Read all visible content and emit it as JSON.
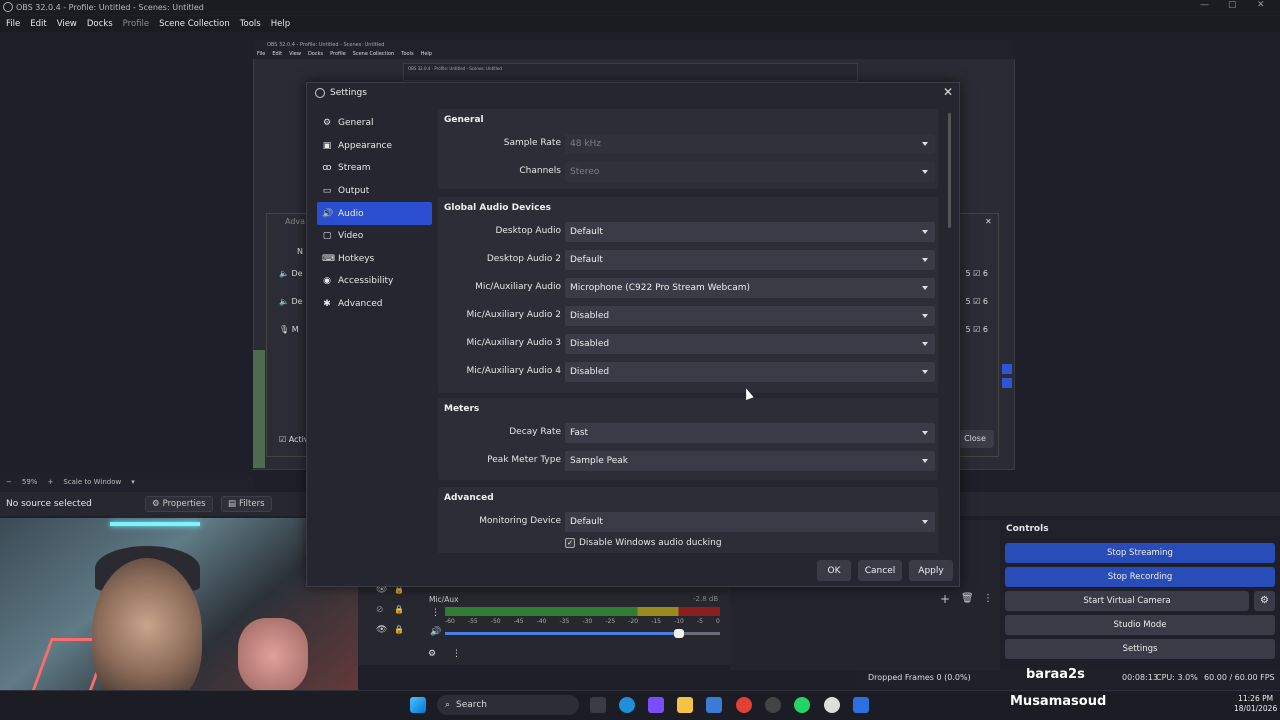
{
  "window": {
    "title": "OBS 32.0.4 - Profile: Untitled - Scenes: Untitled"
  },
  "menu": [
    "File",
    "Edit",
    "View",
    "Docks",
    "Profile",
    "Scene Collection",
    "Tools",
    "Help"
  ],
  "preview": {
    "mini_title": "OBS 32.0.4 - Profile: Untitled - Scenes: Untitled",
    "mini_menu": [
      "File",
      "Edit",
      "View",
      "Docks",
      "Profile",
      "Scene Collection",
      "Tools",
      "Help"
    ],
    "bg_dialog_title": "Adva",
    "bg_rows": [
      "N",
      "De",
      "De",
      "M"
    ],
    "bg_checks": [
      "5",
      "5",
      "5"
    ],
    "bg_active": "Activ",
    "bg_close": "Close"
  },
  "status": {
    "zoom": "59%",
    "scale": "Scale to Window"
  },
  "sources": {
    "no_source": "No source selected",
    "properties": "Properties",
    "filters": "Filters"
  },
  "mixer": {
    "label": "Mic/Aux",
    "db": "-2.8 dB",
    "ticks": [
      "-60",
      "-55",
      "-50",
      "-45",
      "-40",
      "-35",
      "-30",
      "-25",
      "-20",
      "-15",
      "-10",
      "-5",
      "0"
    ],
    "volume_fraction": 0.85
  },
  "controls": {
    "header": "Controls",
    "stop_streaming": "Stop Streaming",
    "stop_recording": "Stop Recording",
    "start_virtual_camera": "Start Virtual Camera",
    "studio_mode": "Studio Mode",
    "settings": "Settings"
  },
  "statusbar": {
    "dropped": "Dropped Frames 0 (0.0%)",
    "time": "00:08:13",
    "cpu": "CPU: 3.0%",
    "fps": "60.00 / 60.00 FPS"
  },
  "overlay": {
    "name_top": "baraa2s",
    "name_bottom": "Musamasoud"
  },
  "taskbar": {
    "search": "Search",
    "clock_time": "11:26 PM",
    "clock_date": "18/01/2026"
  },
  "settings": {
    "title": "Settings",
    "nav": [
      {
        "label": "General",
        "icon": "gear-icon"
      },
      {
        "label": "Appearance",
        "icon": "appearance-icon"
      },
      {
        "label": "Stream",
        "icon": "antenna-icon"
      },
      {
        "label": "Output",
        "icon": "monitor-icon"
      },
      {
        "label": "Audio",
        "icon": "speaker-icon"
      },
      {
        "label": "Video",
        "icon": "video-icon"
      },
      {
        "label": "Hotkeys",
        "icon": "keyboard-icon"
      },
      {
        "label": "Accessibility",
        "icon": "accessibility-icon"
      },
      {
        "label": "Advanced",
        "icon": "wrench-icon"
      }
    ],
    "active_nav": "Audio",
    "general": {
      "header": "General",
      "sample_rate_label": "Sample Rate",
      "sample_rate_value": "48 kHz",
      "channels_label": "Channels",
      "channels_value": "Stereo"
    },
    "global_audio": {
      "header": "Global Audio Devices",
      "rows": [
        {
          "label": "Desktop Audio",
          "value": "Default"
        },
        {
          "label": "Desktop Audio 2",
          "value": "Default"
        },
        {
          "label": "Mic/Auxiliary Audio",
          "value": "Microphone (C922 Pro Stream Webcam)"
        },
        {
          "label": "Mic/Auxiliary Audio 2",
          "value": "Disabled"
        },
        {
          "label": "Mic/Auxiliary Audio 3",
          "value": "Disabled"
        },
        {
          "label": "Mic/Auxiliary Audio 4",
          "value": "Disabled"
        }
      ]
    },
    "meters": {
      "header": "Meters",
      "decay_label": "Decay Rate",
      "decay_value": "Fast",
      "peak_label": "Peak Meter Type",
      "peak_value": "Sample Peak"
    },
    "advanced": {
      "header": "Advanced",
      "monitoring_label": "Monitoring Device",
      "monitoring_value": "Default",
      "ducking_label": "Disable Windows audio ducking",
      "ducking_checked": true
    },
    "buttons": {
      "ok": "OK",
      "cancel": "Cancel",
      "apply": "Apply"
    }
  }
}
